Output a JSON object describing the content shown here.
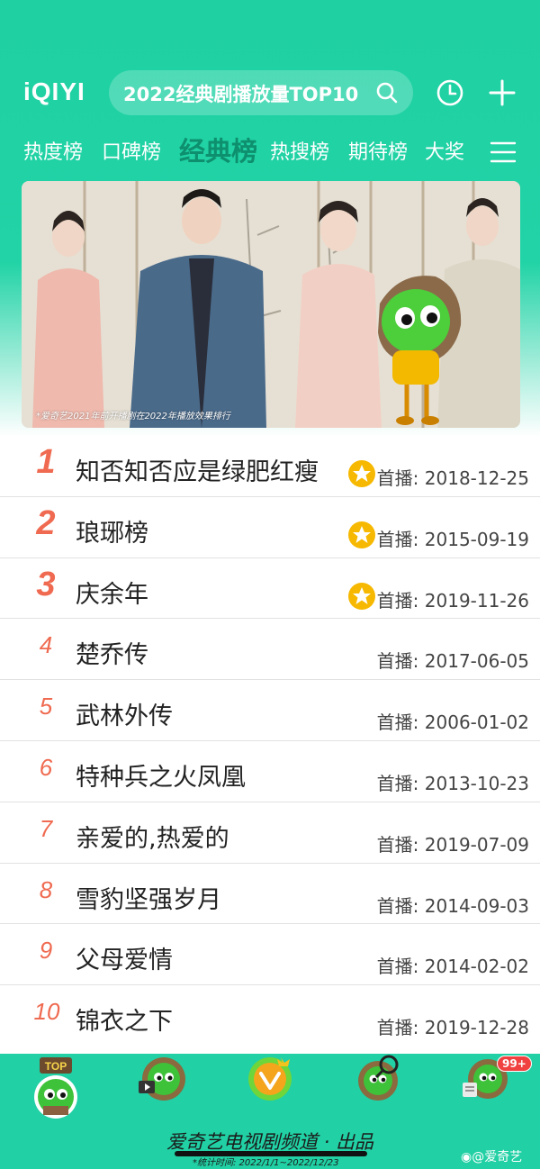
{
  "header": {
    "logo": "iQIYI",
    "search_text": "2022经典剧播放量TOP10",
    "icons": [
      "search-icon",
      "history-icon",
      "add-icon",
      "menu-icon"
    ]
  },
  "tabs": [
    {
      "label": "热度榜",
      "active": false
    },
    {
      "label": "口碑榜",
      "active": false
    },
    {
      "label": "经典榜",
      "active": true
    },
    {
      "label": "热搜榜",
      "active": false
    },
    {
      "label": "期待榜",
      "active": false
    },
    {
      "label": "大奖",
      "active": false
    }
  ],
  "banner": {
    "note": "*爱奇艺2021年前开播剧在2022年播放效果排行"
  },
  "ranking": [
    {
      "rank": "1",
      "title": "知否知否应是绿肥红瘦",
      "starred": true,
      "premiere": "首播: 2018-12-25"
    },
    {
      "rank": "2",
      "title": "琅琊榜",
      "starred": true,
      "premiere": "首播: 2015-09-19"
    },
    {
      "rank": "3",
      "title": "庆余年",
      "starred": true,
      "premiere": "首播: 2019-11-26"
    },
    {
      "rank": "4",
      "title": "楚乔传",
      "starred": false,
      "premiere": "首播: 2017-06-05"
    },
    {
      "rank": "5",
      "title": "武林外传",
      "starred": false,
      "premiere": "首播: 2006-01-02"
    },
    {
      "rank": "6",
      "title": "特种兵之火凤凰",
      "starred": false,
      "premiere": "首播: 2013-10-23"
    },
    {
      "rank": "7",
      "title": "亲爱的,热爱的",
      "starred": false,
      "premiere": "首播: 2019-07-09"
    },
    {
      "rank": "8",
      "title": "雪豹坚强岁月",
      "starred": false,
      "premiere": "首播: 2014-09-03"
    },
    {
      "rank": "9",
      "title": "父母爱情",
      "starred": false,
      "premiere": "首播: 2014-02-02"
    },
    {
      "rank": "10",
      "title": "锦衣之下",
      "starred": false,
      "premiere": "首播: 2019-12-28"
    }
  ],
  "bottom": {
    "top_badge": "TOP",
    "notification_count": "99+",
    "tagline": "爱奇艺电视剧频道 · 出品",
    "stat_period": "*统计时间: 2022/1/1~2022/12/23",
    "weibo": "@爱奇艺"
  },
  "colors": {
    "brand_green": "#21d3a6",
    "active_tab": "#0e8f6d",
    "rank_red": "#ef6a50",
    "star_gold": "#f6b800"
  }
}
